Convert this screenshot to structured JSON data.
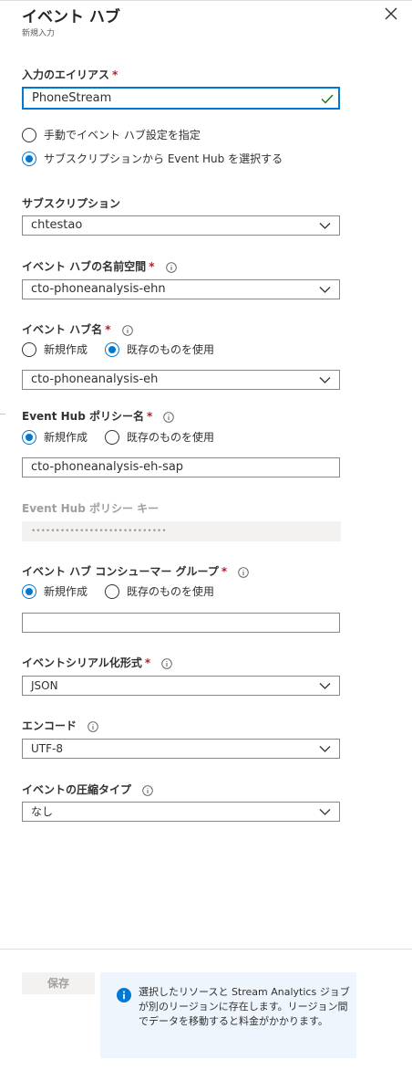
{
  "panel": {
    "title": "イベント ハブ",
    "subtitle": "新規入力"
  },
  "alias": {
    "label": "入力のエイリアス",
    "required": "*",
    "value": "PhoneStream"
  },
  "source_options": [
    {
      "label": "手動でイベント ハブ設定を指定",
      "selected": false
    },
    {
      "label": "サブスクリプションから Event Hub を選択する",
      "selected": true
    }
  ],
  "subscription": {
    "label": "サブスクリプション",
    "value": "chtestao"
  },
  "namespace": {
    "label": "イベント ハブの名前空間",
    "required": "*",
    "value": "cto-phoneanalysis-ehn"
  },
  "hub_name": {
    "label": "イベント ハブ名",
    "required": "*",
    "options": [
      {
        "label": "新規作成",
        "selected": false
      },
      {
        "label": "既存のものを使用",
        "selected": true
      }
    ],
    "value": "cto-phoneanalysis-eh"
  },
  "policy_name": {
    "label": "Event Hub ポリシー名",
    "required": "*",
    "options": [
      {
        "label": "新規作成",
        "selected": true
      },
      {
        "label": "既存のものを使用",
        "selected": false
      }
    ],
    "value": "cto-phoneanalysis-eh-sap"
  },
  "policy_key": {
    "label": "Event Hub ポリシー キー",
    "value": "••••••••••••••••••••••••••••"
  },
  "consumer_group": {
    "label": "イベント ハブ コンシューマー グループ",
    "required": "*",
    "options": [
      {
        "label": "新規作成",
        "selected": true
      },
      {
        "label": "既存のものを使用",
        "selected": false
      }
    ],
    "value": ""
  },
  "serialization": {
    "label": "イベントシリアル化形式",
    "required": "*",
    "value": "JSON"
  },
  "encoding": {
    "label": "エンコード",
    "value": "UTF-8"
  },
  "compression": {
    "label": "イベントの圧縮タイプ",
    "value": "なし"
  },
  "footer": {
    "save_label": "保存",
    "message": "選択したリソースと Stream Analytics ジョブが別のリージョンに存在します。リージョン間でデータを移動すると料金がかかります。"
  },
  "colors": {
    "accent": "#0078d4",
    "required": "#a4262c",
    "success": "#107c10"
  },
  "icons": [
    "close-icon",
    "checkmark-icon",
    "info-icon",
    "chevron-down-icon"
  ]
}
